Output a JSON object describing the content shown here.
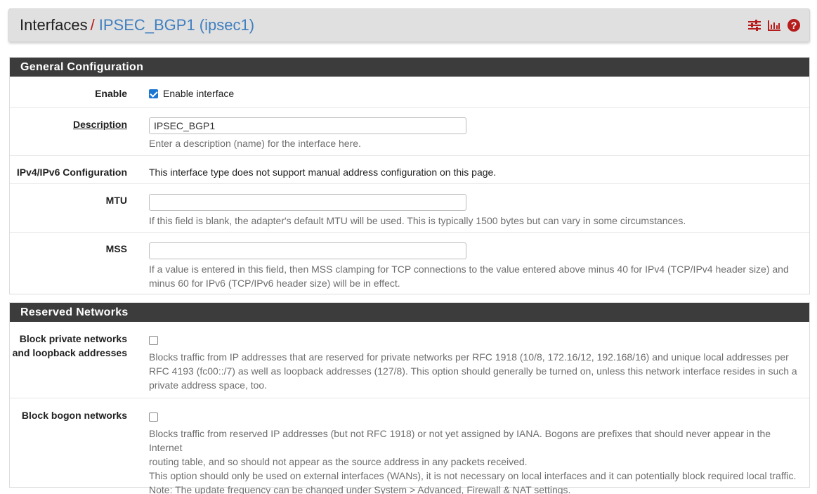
{
  "breadcrumb": {
    "root": "Interfaces",
    "separator": "/",
    "current": "IPSEC_BGP1 (ipsec1)",
    "icons": [
      "sliders-icon",
      "bar-chart-icon",
      "help-icon"
    ]
  },
  "colors": {
    "accent": "#b71c1c",
    "link": "#3f7fbf",
    "header_bg": "#3c3c3c",
    "checkbox": "#1976d2"
  },
  "general": {
    "heading": "General Configuration",
    "enable": {
      "label": "Enable",
      "checkbox_label": "Enable interface",
      "checked": true
    },
    "description": {
      "label": "Description",
      "value": "IPSEC_BGP1",
      "help": "Enter a description (name) for the interface here."
    },
    "ipconfig": {
      "label": "IPv4/IPv6 Configuration",
      "text": "This interface type does not support manual address configuration on this page."
    },
    "mtu": {
      "label": "MTU",
      "value": "",
      "help": "If this field is blank, the adapter's default MTU will be used. This is typically 1500 bytes but can vary in some circumstances."
    },
    "mss": {
      "label": "MSS",
      "value": "",
      "help_line1": "If a value is entered in this field, then MSS clamping for TCP connections to the value entered above minus 40 for IPv4 (TCP/IPv4 header size) and",
      "help_line2": "minus 60 for IPv6 (TCP/IPv6 header size) will be in effect."
    }
  },
  "reserved": {
    "heading": "Reserved Networks",
    "private": {
      "label_line1": "Block private networks",
      "label_line2": "and loopback addresses",
      "checked": false,
      "help_line1": "Blocks traffic from IP addresses that are reserved for private networks per RFC 1918 (10/8, 172.16/12, 192.168/16) and unique local addresses per",
      "help_line2": "RFC 4193 (fc00::/7) as well as loopback addresses (127/8). This option should generally be turned on, unless this network interface resides in such a",
      "help_line3": "private address space, too."
    },
    "bogon": {
      "label": "Block bogon networks",
      "checked": false,
      "help_line1": "Blocks traffic from reserved IP addresses (but not RFC 1918) or not yet assigned by IANA. Bogons are prefixes that should never appear in the Internet",
      "help_line2": "routing table, and so should not appear as the source address in any packets received.",
      "help_line3": "This option should only be used on external interfaces (WANs), it is not necessary on local interfaces and it can potentially block required local traffic.",
      "help_line4": "Note: The update frequency can be changed under System > Advanced, Firewall & NAT settings."
    }
  }
}
